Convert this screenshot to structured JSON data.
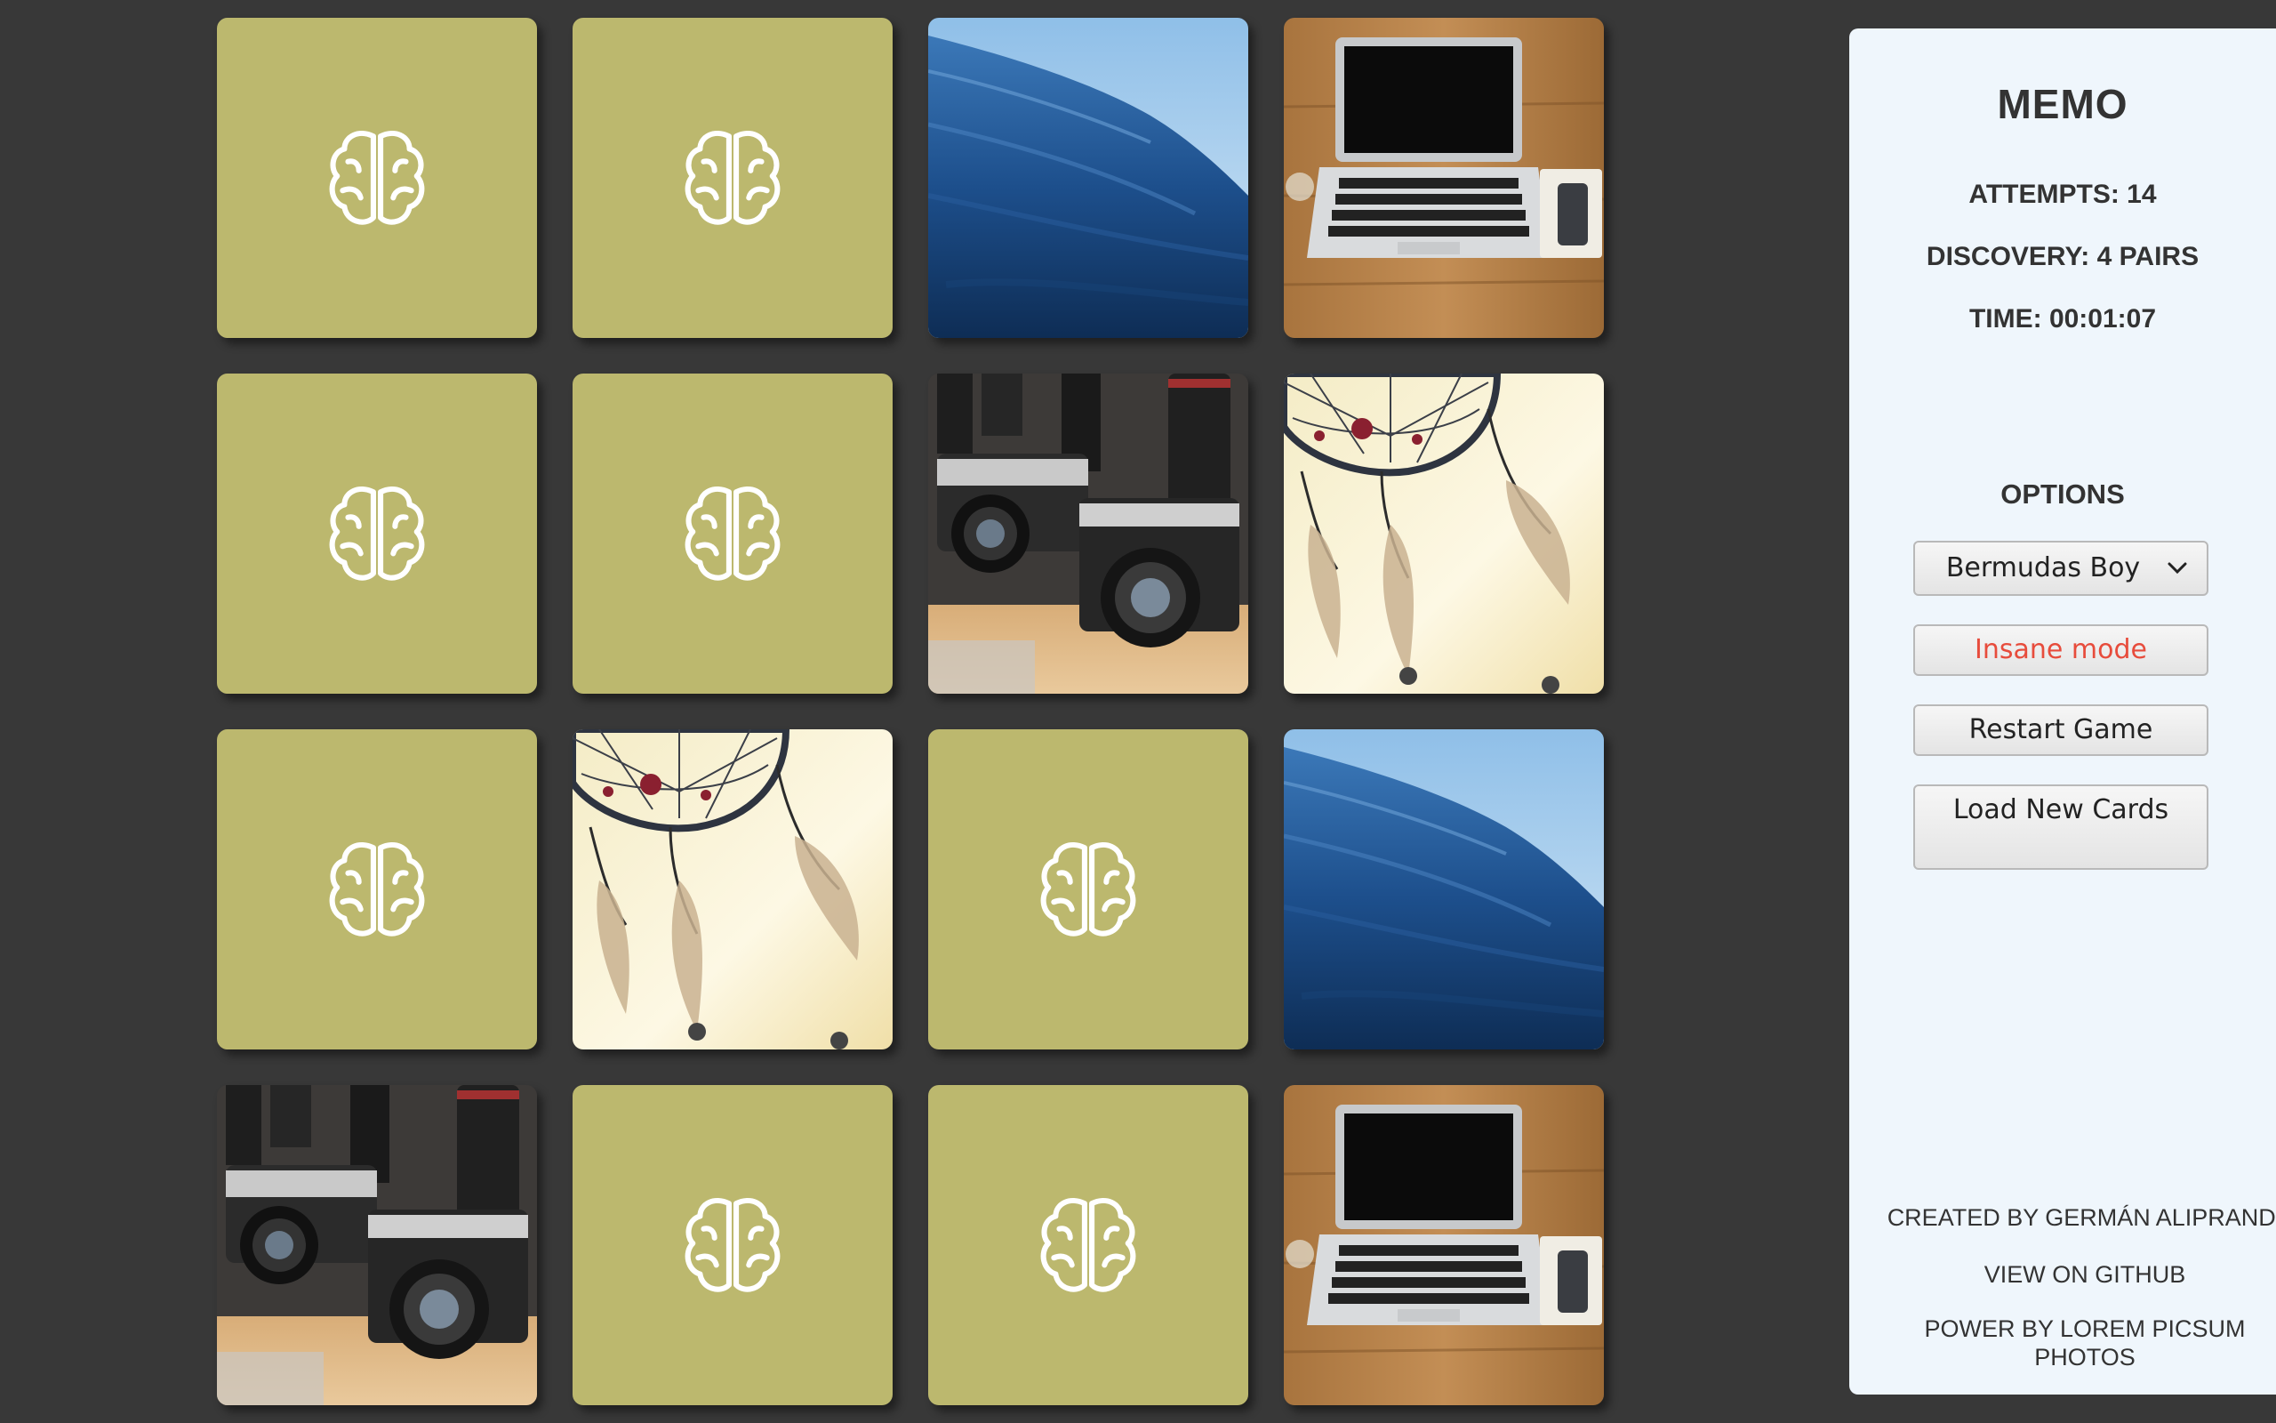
{
  "panel": {
    "title": "MEMO",
    "attempts": "ATTEMPTS: 14",
    "discovery": "DISCOVERY: 4 PAIRS",
    "time": "TIME: 00:01:07",
    "options_title": "OPTIONS",
    "select_value": "Bermudas Boy",
    "insane_label": "Insane mode",
    "restart_label": "Restart Game",
    "load_label": "Load New Cards",
    "credit": "CREATED BY GERMÁN ALIPRANDI",
    "github": "VIEW ON GITHUB",
    "power": "POWER BY LOREM PICSUM PHOTOS"
  },
  "colors": {
    "background": "#383838",
    "card_back": "#bcb86e",
    "panel": "#eff6fc",
    "insane_text": "#e74c3c"
  },
  "cards": [
    {
      "state": "hidden",
      "icon": "brain-icon"
    },
    {
      "state": "hidden",
      "icon": "brain-icon"
    },
    {
      "state": "revealed",
      "image": "ocean-wave"
    },
    {
      "state": "revealed",
      "image": "laptop-desk"
    },
    {
      "state": "hidden",
      "icon": "brain-icon"
    },
    {
      "state": "hidden",
      "icon": "brain-icon"
    },
    {
      "state": "revealed",
      "image": "vintage-cameras"
    },
    {
      "state": "revealed",
      "image": "dreamcatcher"
    },
    {
      "state": "hidden",
      "icon": "brain-icon"
    },
    {
      "state": "revealed",
      "image": "dreamcatcher"
    },
    {
      "state": "hidden",
      "icon": "brain-icon"
    },
    {
      "state": "revealed",
      "image": "ocean-wave"
    },
    {
      "state": "revealed",
      "image": "vintage-cameras"
    },
    {
      "state": "hidden",
      "icon": "brain-icon"
    },
    {
      "state": "hidden",
      "icon": "brain-icon"
    },
    {
      "state": "revealed",
      "image": "laptop-desk"
    }
  ]
}
